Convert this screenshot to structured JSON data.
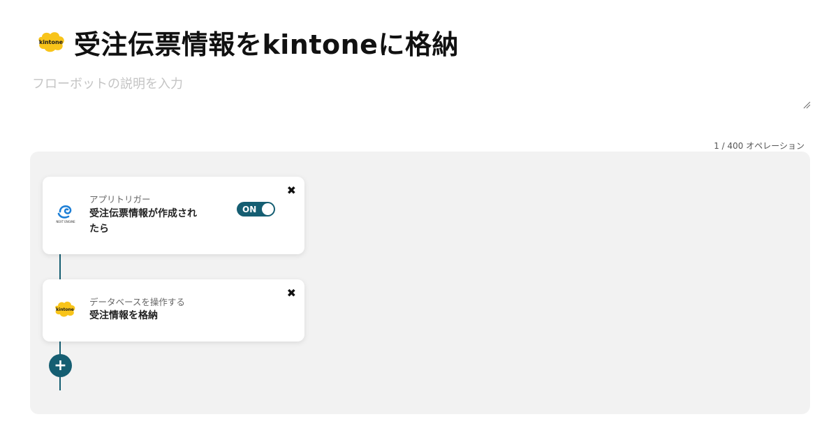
{
  "header": {
    "title": "受注伝票情報をkintoneに格納",
    "logo_text": "kintone",
    "logo_icon": "kintone-logo-icon"
  },
  "description": {
    "placeholder": "フローボットの説明を入力",
    "value": ""
  },
  "operations": {
    "count_text": "1 / 400 オペレーション"
  },
  "steps": [
    {
      "subtitle": "アプリトリガー",
      "title": "受注伝票情報が作成されたら",
      "icon": "next-engine-logo-icon",
      "icon_text": "NEXT ENGINE",
      "toggle_label": "ON"
    },
    {
      "subtitle": "データベースを操作する",
      "title": "受注情報を格納",
      "icon": "kintone-logo-icon",
      "icon_text": "kintone"
    }
  ],
  "colors": {
    "accent": "#155e72",
    "kintone_yellow": "#f8c41a",
    "canvas_bg": "#f2f2f2",
    "next_engine_blue": "#1e7fd6"
  }
}
